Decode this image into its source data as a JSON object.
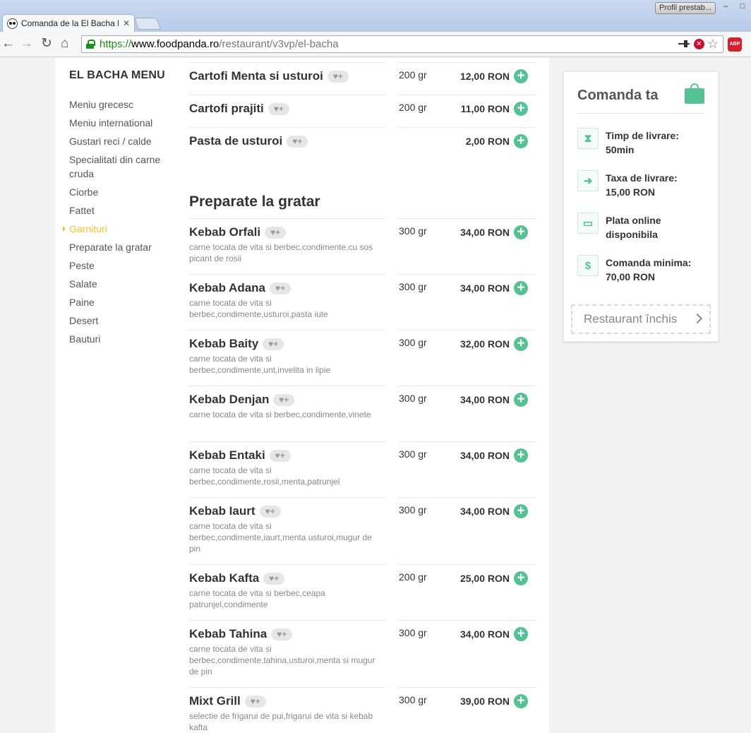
{
  "browser": {
    "tab_title": "Comanda de la El Bacha B",
    "tab_close": "✕",
    "profile_button": "Profil prestab...",
    "url_scheme": "https://",
    "url_host": "www.foodpanda.ro",
    "url_path": "/restaurant/v3vp/el-bacha",
    "abp_label": "ABP"
  },
  "sidebar": {
    "title": "EL BACHA MENU",
    "items": [
      "Meniu grecesc",
      "Meniu international",
      "Gustari reci / calde",
      "Specialitati din carne cruda",
      "Ciorbe",
      "Fattet",
      "Garnituri",
      "Preparate la gratar",
      "Peste",
      "Salate",
      "Paine",
      "Desert",
      "Bauturi"
    ],
    "active_index": 6
  },
  "menu": {
    "fav_label": "♥+",
    "add_label": "+",
    "section_title": "Preparate la gratar",
    "items_top": [
      {
        "name": "Cartofi Menta si usturoi",
        "desc": "",
        "weight": "200 gr",
        "price": "12,00 RON"
      },
      {
        "name": "Cartofi prajiti",
        "desc": "",
        "weight": "200 gr",
        "price": "11,00 RON"
      },
      {
        "name": "Pasta de usturoi",
        "desc": "",
        "weight": "",
        "price": "2,00 RON"
      }
    ],
    "items_grill": [
      {
        "name": "Kebab Orfali",
        "desc": "carne tocata de vita si berbec,condimente,cu sos picant de rosii",
        "weight": "300 gr",
        "price": "34,00 RON"
      },
      {
        "name": "Kebab Adana",
        "desc": "carne tocata de vita si berbec,condimente,usturoi,pasta iute",
        "weight": "300 gr",
        "price": "34,00 RON"
      },
      {
        "name": "Kebab Baity",
        "desc": "carne tocata de vita si berbec,condimente,unt,invelita in lipie",
        "weight": "300 gr",
        "price": "32,00 RON"
      },
      {
        "name": "Kebab Denjan",
        "desc": "carne tocata de vita si berbec,condimente,vinete",
        "weight": "300 gr",
        "price": "34,00 RON"
      },
      {
        "name": "Kebab Entaki",
        "desc": "carne tocata de vita si berbec,condimente,rosii,menta,patrunjel",
        "weight": "300 gr",
        "price": "34,00 RON"
      },
      {
        "name": "Kebab Iaurt",
        "desc": "carne tocata de vita si berbec,condimente,iaurt,menta usturoi,mugur de pin",
        "weight": "300 gr",
        "price": "34,00 RON"
      },
      {
        "name": "Kebab Kafta",
        "desc": "carne tocata de vita si berbec,ceapa patrunjel,condimente",
        "weight": "200 gr",
        "price": "25,00 RON"
      },
      {
        "name": "Kebab Tahina",
        "desc": "carne tocata de vita si berbec,condimente,tahina,usturoi,menta si mugur de pin",
        "weight": "300 gr",
        "price": "34,00 RON"
      },
      {
        "name": "Mixt Grill",
        "desc": "selectie de frigarui de pui,frigarui de vita si kebab kafta",
        "weight": "300 gr",
        "price": "39,00 RON"
      }
    ]
  },
  "cart": {
    "title": "Comanda ta",
    "info": [
      {
        "icon": "hourglass-icon",
        "text": "Timp de livrare: 50min"
      },
      {
        "icon": "scooter-icon",
        "text": "Taxa de livrare: 15,00 RON"
      },
      {
        "icon": "card-icon",
        "text": "Plata online disponibila"
      },
      {
        "icon": "coins-icon",
        "text": "Comanda minima: 70,00 RON"
      }
    ],
    "closed_label": "Restaurant închis"
  },
  "colors": {
    "accent": "#55c195",
    "active_nav": "#f0c030"
  }
}
